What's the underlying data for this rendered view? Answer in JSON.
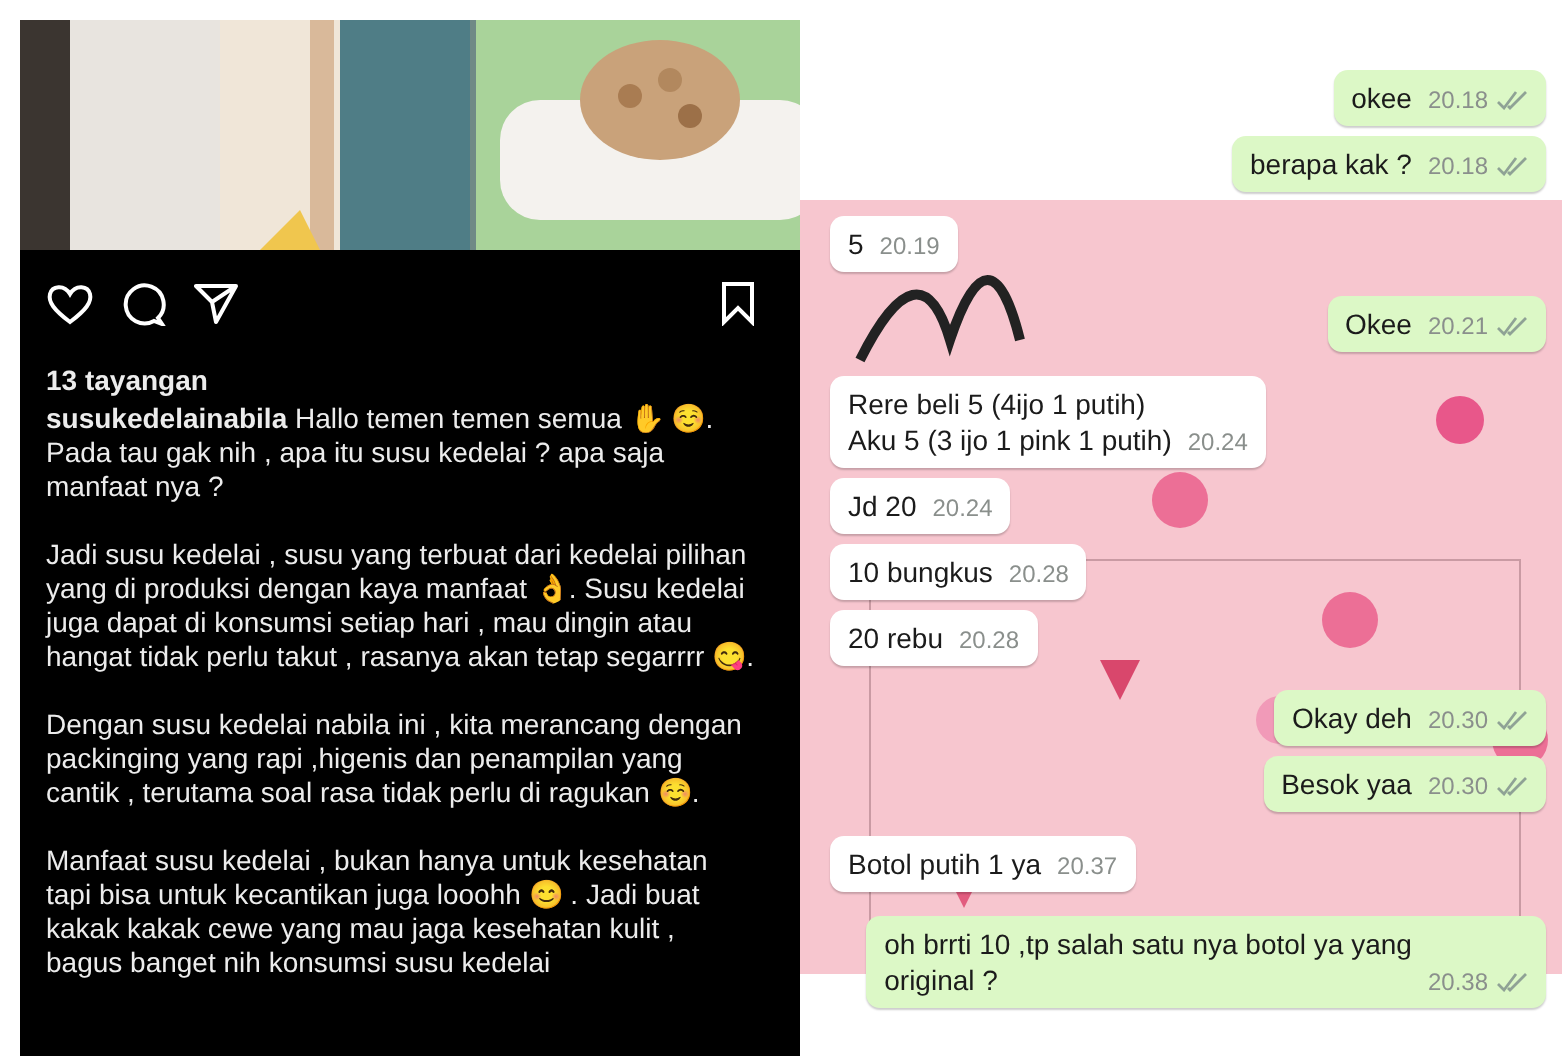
{
  "instagram_post": {
    "kind": "picture",
    "views": "13 tayangan",
    "caption": [
      "**susukedelainabila** Hallo temen temen semua ✋ ☺️. Pada tau gak nih , apa itu susu kedelai ? apa saja manfaat nya ?",
      "Jadi susu kedelai , susu yang terbuat dari kedelai pilihan yang di produksi dengan kaya manfaat 👌. Susu kedelai juga dapat di konsumsi setiap hari , mau dingin atau hangat tidak perlu takut , rasanya akan tetap segarrrr 😋.",
      "Dengan susu kedelai nabila ini , kita merancang dengan packinging yang rapi ,higenis dan penampilan yang cantik , terutama soal rasa tidak perlu di ragukan ☺️.",
      "Manfaat susu kedelai , bukan hanya untuk kesehatan tapi bisa untuk kecantikan juga looohh 😊 . Jadi buat kakak kakak cewe yang mau jaga kesehatan kulit , bagus banget nih konsumsi susu kedelai"
    ]
  },
  "chat": {
    "messages": [
      {
        "kind": "outgoing",
        "text": "okee",
        "time": "20.18",
        "delivered": true
      },
      {
        "kind": "outgoing",
        "text": "berapa kak ?",
        "time": "20.18",
        "delivered": true
      },
      {
        "kind": "incoming",
        "text": "5",
        "time": "20.19"
      },
      {
        "kind": "outgoing",
        "text": "Okee",
        "time": "20.21",
        "delivered": true
      },
      {
        "kind": "incoming",
        "text": "Rere beli 5 (4ijo 1 putih)\nAku 5 (3 ijo 1 pink 1 putih)",
        "time": "20.24"
      },
      {
        "kind": "incoming",
        "text": "Jd 20",
        "time": "20.24"
      },
      {
        "kind": "incoming",
        "text": "10 bungkus",
        "time": "20.28"
      },
      {
        "kind": "incoming",
        "text": "20 rebu",
        "time": "20.28"
      },
      {
        "kind": "outgoing",
        "text": "Okay deh",
        "time": "20.30",
        "delivered": true
      },
      {
        "kind": "outgoing",
        "text": "Besok yaa",
        "time": "20.30",
        "delivered": true
      },
      {
        "kind": "incoming",
        "text": "Botol putih 1 ya",
        "time": "20.37"
      },
      {
        "kind": "outgoing",
        "text": "oh brrti 10 ,tp salah satu nya botol ya yang\noriginal ?",
        "time": "20.38",
        "delivered": true
      }
    ]
  }
}
